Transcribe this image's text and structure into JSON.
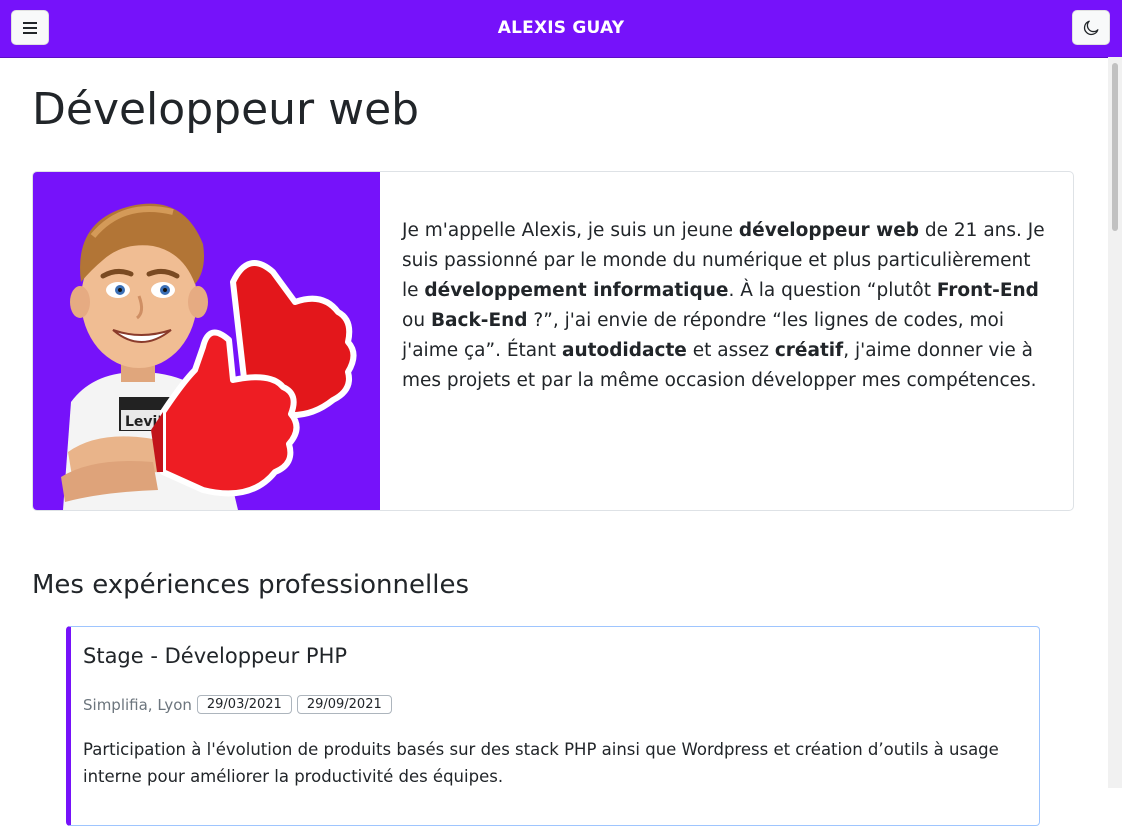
{
  "header": {
    "brand": "ALEXIS GUAY",
    "menu_icon": "hamburger-menu-icon",
    "theme_icon": "moon-icon",
    "color": "#7612fa"
  },
  "main": {
    "title": "Développeur web",
    "intro": {
      "avatar_icon": "memoji-thumbs-up-avatar",
      "paragraph": [
        {
          "text": "Je m'appelle Alexis, je suis un jeune ",
          "bold": false
        },
        {
          "text": "développeur web",
          "bold": true
        },
        {
          "text": " de 21 ans. Je suis passionné par le monde du numérique et plus particulièrement le ",
          "bold": false
        },
        {
          "text": "développement informatique",
          "bold": true
        },
        {
          "text": ". À la question “plutôt ",
          "bold": false
        },
        {
          "text": "Front-End",
          "bold": true
        },
        {
          "text": " ou ",
          "bold": false
        },
        {
          "text": "Back-End",
          "bold": true
        },
        {
          "text": " ?”, j'ai envie de répondre “les lignes de codes, moi j'aime ça”. Étant ",
          "bold": false
        },
        {
          "text": "autodidacte",
          "bold": true
        },
        {
          "text": " et assez ",
          "bold": false
        },
        {
          "text": "créatif",
          "bold": true
        },
        {
          "text": ", j'aime donner vie à mes projets et par la même occasion développer mes compétences.",
          "bold": false
        }
      ]
    },
    "experiences_title": "Mes expériences professionnelles",
    "experiences": [
      {
        "title": "Stage - Développeur PHP",
        "company": "Simplifia, Lyon",
        "start": "29/03/2021",
        "end": "29/09/2021",
        "description": "Participation à l'évolution de produits basés sur des stack PHP ainsi que Wordpress et création d’outils à usage interne pour améliorer la productivité des équipes."
      }
    ]
  }
}
